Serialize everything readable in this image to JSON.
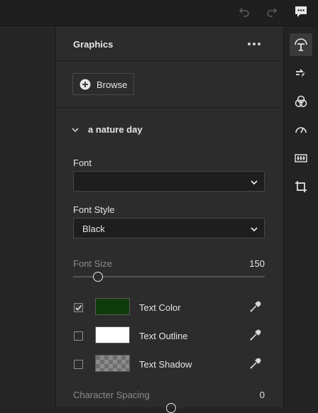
{
  "topbar": {
    "icons": [
      "undo-icon",
      "redo-icon",
      "comment-icon"
    ]
  },
  "panel": {
    "title": "Graphics",
    "more_icon": "ellipsis-icon",
    "browse_label": "Browse",
    "layer_name": "a nature day",
    "font": {
      "label": "Font",
      "value": ""
    },
    "font_style": {
      "label": "Font Style",
      "value": "Black"
    },
    "font_size": {
      "label": "Font Size",
      "value": "150",
      "slider_fraction": 0.13
    },
    "appearance": [
      {
        "label": "Text Color",
        "checked": true,
        "swatch": "#0f3a0a"
      },
      {
        "label": "Text Outline",
        "checked": false,
        "swatch": "#ffffff"
      },
      {
        "label": "Text Shadow",
        "checked": false,
        "swatch": "checker"
      }
    ],
    "character_spacing": {
      "label": "Character Spacing",
      "value": "0"
    }
  },
  "rail": {
    "icons": [
      "text-graphics-icon",
      "transitions-icon",
      "color-icon",
      "speed-icon",
      "audio-levels-icon",
      "crop-icon"
    ],
    "active": "text-graphics-icon"
  },
  "colors": {
    "accent_active": "#3a3a3a",
    "text": "#e6e6e6",
    "muted": "#8b8b8b"
  }
}
